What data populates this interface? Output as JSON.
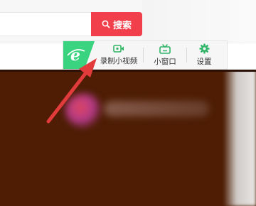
{
  "search": {
    "button_label": "搜索",
    "input_value": "",
    "icon": "search-icon"
  },
  "toolbar": {
    "brand_icon": "browser-e-logo-icon",
    "items": [
      {
        "label": "录制小视频",
        "icon": "video-record-icon"
      },
      {
        "label": "小窗口",
        "icon": "tv-mini-window-icon"
      },
      {
        "label": "设置",
        "icon": "gear-icon"
      }
    ]
  },
  "annotation": {
    "icon": "red-arrow-icon",
    "target": "录制小视频"
  },
  "colors": {
    "search_button": "#f1404b",
    "brand_green": "#3ad37f",
    "icon_green": "#2fb567",
    "video_background": "#4e1d04",
    "arrow_red": "#e23b3b"
  }
}
